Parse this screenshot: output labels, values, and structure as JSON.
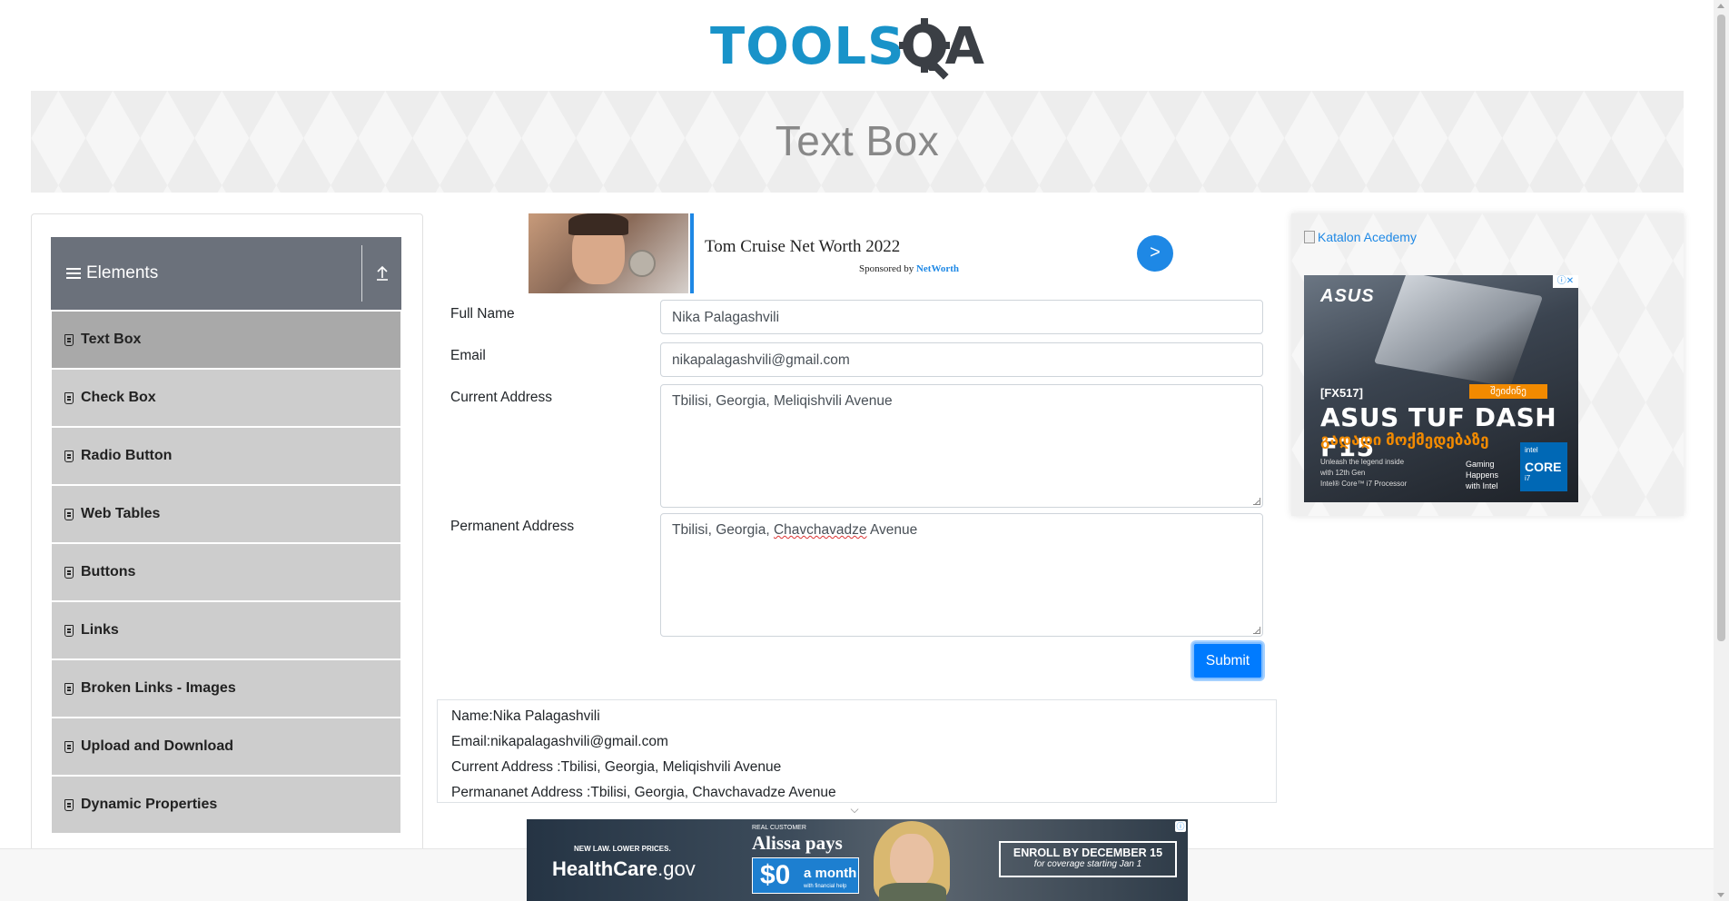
{
  "header": {
    "logo_tools": "TOOLS",
    "logo_qa": "QA"
  },
  "banner": {
    "title": "Text Box"
  },
  "sidebar": {
    "group_title": "Elements",
    "items": [
      {
        "label": "Text Box",
        "active": true,
        "icon": "form-icon"
      },
      {
        "label": "Check Box",
        "icon": "form-icon"
      },
      {
        "label": "Radio Button",
        "icon": "form-icon"
      },
      {
        "label": "Web Tables",
        "icon": "form-icon"
      },
      {
        "label": "Buttons",
        "icon": "form-icon"
      },
      {
        "label": "Links",
        "icon": "form-icon"
      },
      {
        "label": "Broken Links - Images",
        "icon": "form-icon"
      },
      {
        "label": "Upload and Download",
        "icon": "form-icon"
      },
      {
        "label": "Dynamic Properties",
        "icon": "form-icon"
      }
    ]
  },
  "ad_top": {
    "headline": "Tom Cruise Net Worth 2022",
    "sponsor_prefix": "Sponsored by",
    "sponsor_name": "NetWorth",
    "arrow": ">"
  },
  "form": {
    "full_name_label": "Full Name",
    "full_name_value": "Nika Palagashvili",
    "email_label": "Email",
    "email_value": "nikapalagashvili@gmail.com",
    "current_address_label": "Current Address",
    "current_address_value": "Tbilisi, Georgia, Meliqishvili Avenue",
    "permanent_address_label": "Permanent Address",
    "permanent_address_value_prefix": "Tbilisi, Georgia, ",
    "permanent_address_value_misspelled": "Chavchavadze",
    "permanent_address_value_suffix": " Avenue",
    "submit_label": "Submit"
  },
  "output": {
    "name": "Name:Nika Palagashvili",
    "email": "Email:nikapalagashvili@gmail.com",
    "current_address": "Current Address :Tbilisi, Georgia, Meliqishvili Avenue",
    "permanent_address": "Permananet Address :Tbilisi, Georgia, Chavchavadze Avenue"
  },
  "right_ad": {
    "broken_image_alt": "Katalon Acedemy",
    "brand": "ASUS",
    "model": "[FX517]",
    "badge": "შეიძინე",
    "title": "ASUS TUF DASH F15",
    "georgian_line": "გადადი მოქმედებაზე",
    "small_text_1": "Unleash the legend inside",
    "small_text_2": "with 12th Gen",
    "small_text_3": "Intel® Core™ i7 Processor",
    "gaming_1": "Gaming",
    "gaming_2": "Happens",
    "gaming_3": "with Intel",
    "intel_top": "intel",
    "intel_core": "CORE",
    "intel_i": "i7"
  },
  "bottom_ad": {
    "law": "NEW LAW. LOWER PRICES.",
    "healthcare_1": "HealthCare",
    "healthcare_2": ".gov",
    "real_customer": "REAL CUSTOMER",
    "alissa": "Alissa pays",
    "price": "$0",
    "per": "a month",
    "with": "with financial help",
    "enroll": "ENROLL BY DECEMBER 15",
    "coverage": "for coverage starting Jan 1"
  }
}
